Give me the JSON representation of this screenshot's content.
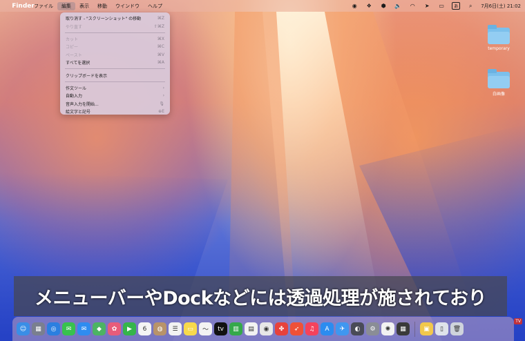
{
  "menubar": {
    "apple_icon": "apple-logo",
    "app_name": "Finder",
    "menus": [
      "ファイル",
      "編集",
      "表示",
      "移動",
      "ウインドウ",
      "ヘルプ"
    ],
    "active_menu": "編集",
    "status_icons": [
      "record-icon",
      "dropbox-icon",
      "shield-icon",
      "volume-icon",
      "wifi-icon",
      "location-icon",
      "control-center-icon"
    ],
    "ime": "あ",
    "clock": "7月6日(土) 21:02"
  },
  "edit_menu": [
    {
      "label": "取り消す - \"スクリーンショット\" の移動",
      "shortcut": "⌘Z",
      "disabled": false
    },
    {
      "label": "やり直す",
      "shortcut": "⇧⌘Z",
      "disabled": true
    },
    {
      "sep": true
    },
    {
      "label": "カット",
      "shortcut": "⌘X",
      "disabled": true
    },
    {
      "label": "コピー",
      "shortcut": "⌘C",
      "disabled": true
    },
    {
      "label": "ペースト",
      "shortcut": "⌘V",
      "disabled": true
    },
    {
      "label": "すべてを選択",
      "shortcut": "⌘A",
      "disabled": false
    },
    {
      "sep": true
    },
    {
      "label": "クリップボードを表示",
      "shortcut": "",
      "disabled": false
    },
    {
      "sep": true
    },
    {
      "label": "作文ツール",
      "shortcut": "›",
      "disabled": false
    },
    {
      "label": "自動入力",
      "shortcut": "›",
      "disabled": false
    },
    {
      "label": "音声入力を開始...",
      "shortcut": "🎙",
      "disabled": false
    },
    {
      "label": "絵文字と記号",
      "shortcut": "⊕E",
      "disabled": false
    }
  ],
  "desktop": {
    "folder1": "temporary",
    "folder2": "白画像"
  },
  "caption": "メニューバーやDockなどには透過処理が施されており",
  "dock": {
    "apps": [
      {
        "name": "finder-icon",
        "glyph": "☺",
        "color": "#3a8ee6"
      },
      {
        "name": "launchpad-icon",
        "glyph": "▦",
        "color": "#7a7f8f"
      },
      {
        "name": "safari-icon",
        "glyph": "◎",
        "color": "#2b7fe0"
      },
      {
        "name": "messages-icon",
        "glyph": "✉",
        "color": "#38c24d"
      },
      {
        "name": "mail-icon",
        "glyph": "✉",
        "color": "#2f8cf0"
      },
      {
        "name": "maps-icon",
        "glyph": "◆",
        "color": "#4cb463"
      },
      {
        "name": "photos-icon",
        "glyph": "✿",
        "color": "#e85c7a"
      },
      {
        "name": "facetime-icon",
        "glyph": "▶",
        "color": "#35b54a"
      },
      {
        "name": "calendar-icon",
        "glyph": "6",
        "color": "#f4f4f4"
      },
      {
        "name": "contacts-icon",
        "glyph": "◍",
        "color": "#b8936a"
      },
      {
        "name": "reminders-icon",
        "glyph": "☰",
        "color": "#f2f2f2"
      },
      {
        "name": "notes-icon",
        "glyph": "▭",
        "color": "#f7d94c"
      },
      {
        "name": "freeform-icon",
        "glyph": "〜",
        "color": "#f3f3f3"
      },
      {
        "name": "appletv-icon",
        "glyph": "tv",
        "color": "#111111"
      },
      {
        "name": "numbers-icon",
        "glyph": "▥",
        "color": "#35a84a"
      },
      {
        "name": "keynote-icon",
        "glyph": "▤",
        "color": "#f2f2f2"
      },
      {
        "name": "chrome-icon",
        "glyph": "◉",
        "color": "#e7e7e7"
      },
      {
        "name": "paw-icon",
        "glyph": "✤",
        "color": "#e7423c"
      },
      {
        "name": "swift-icon",
        "glyph": "➶",
        "color": "#f05138"
      },
      {
        "name": "music-icon",
        "glyph": "♫",
        "color": "#f5425c"
      },
      {
        "name": "appstore-icon",
        "glyph": "A",
        "color": "#2b8cf0"
      },
      {
        "name": "bird-icon",
        "glyph": "✈",
        "color": "#3f97f0"
      },
      {
        "name": "vpn-icon",
        "glyph": "◐",
        "color": "#494b57"
      },
      {
        "name": "settings-icon",
        "glyph": "⚙",
        "color": "#8a8d96"
      },
      {
        "name": "chatgpt-icon",
        "glyph": "✺",
        "color": "#f2f2f2"
      },
      {
        "name": "calculator-icon",
        "glyph": "▦",
        "color": "#3a3a3a"
      },
      {
        "name": "archive-icon",
        "glyph": "▣",
        "color": "#f2c84c"
      },
      {
        "name": "downloads-icon",
        "glyph": "▯",
        "color": "#dfe3ea"
      },
      {
        "name": "trash-icon",
        "glyph": "🗑",
        "color": "#cfd4dc"
      }
    ],
    "tv_badge": "TV"
  }
}
